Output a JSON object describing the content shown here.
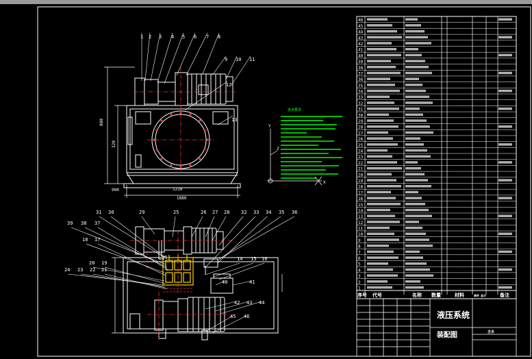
{
  "title_block": {
    "header_labels": [
      "序号",
      "代号",
      "名称",
      "数量",
      "材料",
      "单件",
      "总计",
      "备注"
    ],
    "weight_label": "重量",
    "drawing_title": "液压系统",
    "drawing_subtitle": "装配图"
  },
  "front_view": {
    "balloons": [
      "1",
      "2",
      "3",
      "4",
      "5",
      "6",
      "7",
      "8",
      "9",
      "10",
      "11",
      "12",
      "13"
    ],
    "dimensions": [
      "880",
      "320",
      "1210",
      "1880",
      "900"
    ]
  },
  "top_view": {
    "balloons": [
      "31",
      "30",
      "29",
      "25",
      "26",
      "27",
      "28",
      "32",
      "33",
      "34",
      "35",
      "36",
      "39",
      "38",
      "37",
      "18",
      "17",
      "20",
      "19",
      "24",
      "23",
      "22",
      "21",
      "14",
      "15",
      "16",
      "40",
      "41",
      "42",
      "43",
      "44",
      "45",
      "46"
    ]
  },
  "tech_notes_title": "技术要求",
  "axis_labels": [
    "Y",
    "Z",
    "X"
  ],
  "parts_list": [
    "46",
    "45",
    "44",
    "43",
    "42",
    "41",
    "40",
    "39",
    "38",
    "37",
    "36",
    "35",
    "34",
    "33",
    "32",
    "31",
    "30",
    "29",
    "28",
    "27",
    "26",
    "25",
    "24",
    "23",
    "22",
    "21",
    "20",
    "19",
    "18",
    "17",
    "16",
    "15",
    "14",
    "13",
    "12",
    "11",
    "10",
    "9",
    "8",
    "7",
    "6",
    "5",
    "4",
    "3",
    "2",
    "1"
  ],
  "colors": {
    "outline": "#ffffff",
    "centerline": "#ff3030",
    "hidden": "#ff3030",
    "valve": "#ffd400",
    "notes": "#00ff00",
    "dims": "#ffffff"
  }
}
